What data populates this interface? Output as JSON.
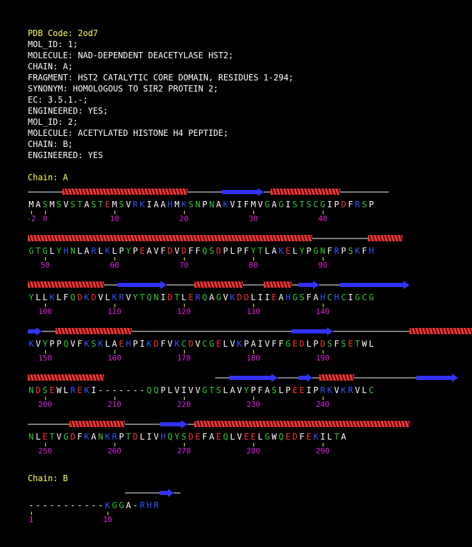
{
  "header": {
    "pdb_code": "PDB Code: 2od7",
    "lines": [
      "MOL_ID: 1;",
      "MOLECULE: NAD-DEPENDENT DEACETYLASE HST2;",
      "CHAIN: A;",
      "FRAGMENT: HST2 CATALYTIC CORE DOMAIN, RESIDUES 1-294;",
      "SYNONYM: HOMOLOGOUS TO SIR2 PROTEIN 2;",
      "EC: 3.5.1.-;",
      "ENGINEERED: YES;",
      "MOL_ID: 2;",
      "MOLECULE: ACETYLATED HISTONE H4 PEPTIDE;",
      "CHAIN: B;",
      "ENGINEERED: YES"
    ]
  },
  "colors": {
    "background": "#000000",
    "header_code": "#ffff66",
    "chain_label": "#ffff66",
    "numbers": "#dd22dd",
    "ticks": "#ffff00",
    "helix": "#ee3333",
    "strand": "#3333ff",
    "coil": "#ffffff",
    "residue_hydrophobic": "#ffffff",
    "residue_polar": "#33cc33",
    "residue_acidic": "#ff3333",
    "residue_basic": "#3355ff",
    "residue_gap": "#ffffff"
  },
  "chains": [
    {
      "label": "Chain: A",
      "blocks": [
        {
          "seq": "MASMSVSTASTEMSVRKIAAHMKSNPNAKVIFMVGAGISTSCGIPDFRSP",
          "ss": "-----HHHHHHHHHHHHHHHHHH-----EEEEEE-HHHHHHHHHH-------",
          "numbers": [
            [
              "-2",
              0
            ],
            [
              "0",
              2
            ],
            [
              "10",
              12
            ],
            [
              "20",
              22
            ],
            [
              "30",
              32
            ],
            [
              "40",
              42
            ]
          ]
        },
        {
          "seq": "GTGLYHNLARLKLPYPEAVFDVDFFQSDPLPFYTLAKELYPGNFRPSKFH",
          "ss": "HHHHHHHHHHHHHHHHHHHHHHHHHHHHHHHHHHHHHHHHH--------HHHHH",
          "numbers": [
            [
              "50",
              2
            ],
            [
              "60",
              12
            ],
            [
              "70",
              22
            ],
            [
              "80",
              32
            ],
            [
              "90",
              42
            ]
          ]
        },
        {
          "seq": "YLLKLFQDKDVLKRVYTQNIDTLERQAGVKDDLIIEAHGSFAHCHCIGCG",
          "ss": "HHHHHHHHHHH--EEEEEEE----HHHHHHH---HHHH-EEE---EEEEEEEEEE",
          "numbers": [
            [
              "100",
              2
            ],
            [
              "110",
              12
            ],
            [
              "120",
              22
            ],
            [
              "130",
              32
            ],
            [
              "140",
              42
            ]
          ]
        },
        {
          "seq": "KVYPPQVFKSKLAEHPIKDFVKCDVCGELVKPAIVFFGEDLPDSFSETWL",
          "ss": "EE--HHHHHHHHHHH-----------------------EEEEEE-----------HHHHHHHHHHHH",
          "numbers": [
            [
              "150",
              2
            ],
            [
              "160",
              12
            ],
            [
              "170",
              22
            ],
            [
              "180",
              32
            ],
            [
              "190",
              42
            ]
          ]
        },
        {
          "seq": "NDSEWLREKI-------QQPLVIVVGTSLAVYPFASLPEEIPRKVKRVLC",
          "ss": "HHHHHHHHHHH                --EEEEEEE---EE-HHHHH---------EEEEEE",
          "numbers": [
            [
              "200",
              2
            ],
            [
              "210",
              12
            ],
            [
              "220",
              22
            ],
            [
              "230",
              32
            ],
            [
              "240",
              42
            ]
          ]
        },
        {
          "seq": "NLETVGDFKANKRPTDLIVHQYSDEFAEQLVEELGWQEDFEKILTA",
          "ss": "------HHHHHHHH-----EEEE-HHHHHHHHHHHHHHHHHHHHHHHHHHHHHHH",
          "numbers": [
            [
              "250",
              2
            ],
            [
              "260",
              12
            ],
            [
              "270",
              22
            ],
            [
              "280",
              32
            ],
            [
              "290",
              42
            ]
          ]
        }
      ]
    },
    {
      "label": "Chain: B",
      "blocks": [
        {
          "seq": "-----------KGGA-RHR",
          "ss": "              -----EE-",
          "numbers": [
            [
              "1",
              0
            ],
            [
              "10",
              11
            ]
          ]
        }
      ]
    }
  ]
}
